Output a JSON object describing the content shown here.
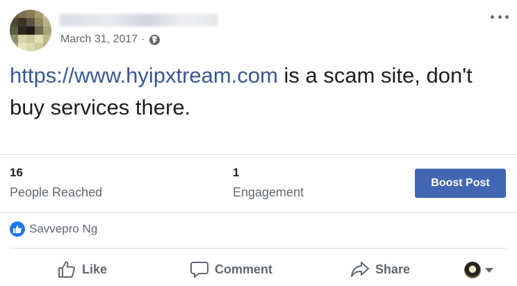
{
  "post": {
    "date": "March 31, 2017",
    "date_separator": "·",
    "privacy_icon": "globe-icon",
    "link_text": "https://www.hyipxtream.com",
    "body_text": " is a scam site, don't buy services there."
  },
  "stats": {
    "reached_value": "16",
    "reached_label": "People Reached",
    "engagement_value": "1",
    "engagement_label": "Engagement",
    "boost_label": "Boost Post"
  },
  "reactions": {
    "icon": "like-reaction-icon",
    "names": "Savvepro Ng"
  },
  "actions": {
    "like_label": "Like",
    "comment_label": "Comment",
    "share_label": "Share"
  },
  "colors": {
    "link": "#385898",
    "boost_button": "#4267b2",
    "like_reaction": "#1877f2",
    "secondary_text": "#606770"
  }
}
